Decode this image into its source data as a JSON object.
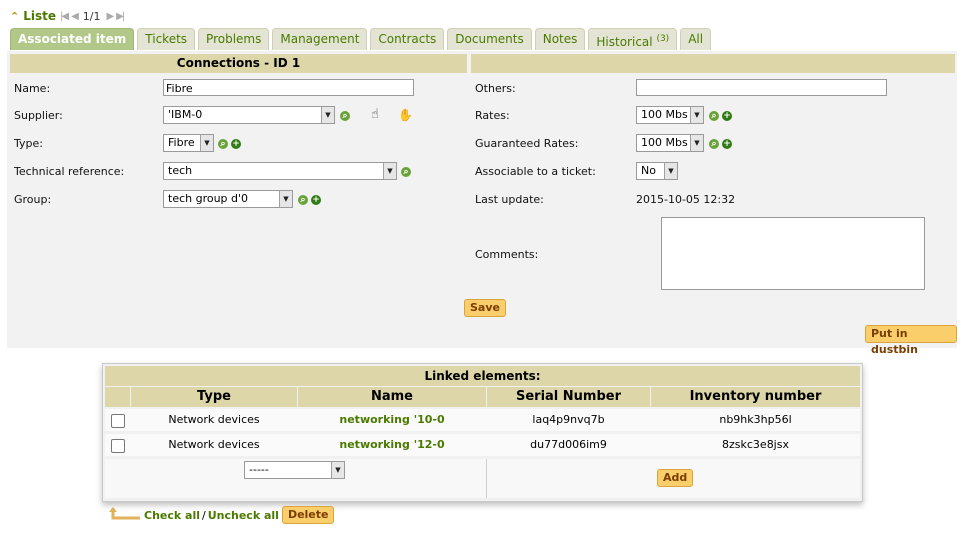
{
  "nav": {
    "liste_label": "Liste",
    "pager": "1/1"
  },
  "tabs": [
    {
      "label": "Associated item",
      "active": true
    },
    {
      "label": "Tickets"
    },
    {
      "label": "Problems"
    },
    {
      "label": "Management"
    },
    {
      "label": "Contracts"
    },
    {
      "label": "Documents"
    },
    {
      "label": "Notes"
    },
    {
      "label": "Historical",
      "count": "(3)"
    },
    {
      "label": "All"
    }
  ],
  "form": {
    "title": "Connections - ID 1",
    "name_label": "Name:",
    "name_value": "Fibre",
    "supplier_label": "Supplier:",
    "supplier_value": "'IBM-0",
    "type_label": "Type:",
    "type_value": "Fibre",
    "techref_label": "Technical reference:",
    "techref_value": "tech",
    "group_label": "Group:",
    "group_value": "tech group d'0",
    "others_label": "Others:",
    "others_value": "",
    "rates_label": "Rates:",
    "rates_value": "100 Mbs",
    "guaranteed_label": "Guaranteed Rates:",
    "guaranteed_value": "100 Mbs",
    "assoc_label": "Associable to a ticket:",
    "assoc_value": "No",
    "lastupdate_label": "Last update:",
    "lastupdate_value": "2015-10-05 12:32",
    "comments_label": "Comments:",
    "save_label": "Save",
    "dustbin_label": "Put in dustbin"
  },
  "linked": {
    "title": "Linked elements:",
    "columns": [
      "Type",
      "Name",
      "Serial Number",
      "Inventory number"
    ],
    "rows": [
      {
        "type": "Network devices",
        "name": "networking '10-0",
        "serial": "laq4p9nvq7b",
        "inventory": "nb9hk3hp56l"
      },
      {
        "type": "Network devices",
        "name": "networking '12-0",
        "serial": "du77d006im9",
        "inventory": "8zskc3e8jsx"
      }
    ],
    "select_value": "-----",
    "add_label": "Add"
  },
  "actions": {
    "check_all": "Check all",
    "separator": "/",
    "uncheck_all": "Uncheck all",
    "delete_label": "Delete"
  },
  "colors": {
    "header_bg": "#dcd6a9",
    "link_green": "#4a7a00",
    "button_bg": "#fbce6c",
    "active_tab": "#b2c889"
  }
}
